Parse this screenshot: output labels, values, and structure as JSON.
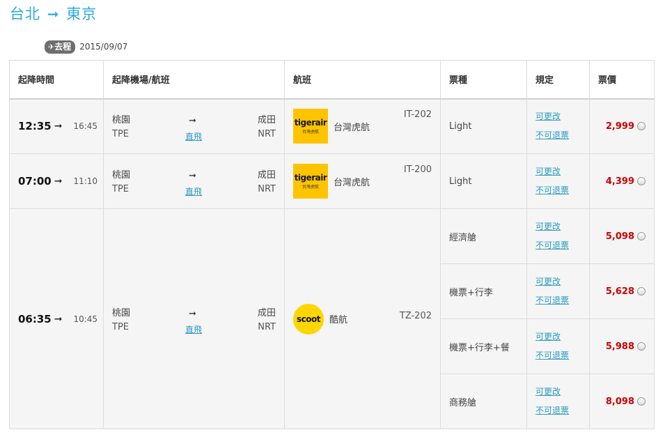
{
  "route": {
    "from": "台北",
    "arrow": "➞",
    "to": "東京"
  },
  "leg": {
    "badge_icon": "✈",
    "badge_label": "去程",
    "date": "2015/09/07"
  },
  "headers": {
    "time": "起降時間",
    "airport": "起降機場/航班",
    "flight": "航班",
    "fare": "票種",
    "rule": "規定",
    "price": "票價"
  },
  "flights": [
    {
      "dep": "12:35",
      "arr": "16:45",
      "from_name": "桃園",
      "from_code": "TPE",
      "to_name": "成田",
      "to_code": "NRT",
      "direct": "直飛",
      "carrier": "台灣虎航",
      "logo": "tigerair",
      "logo_sub": "台灣虎航",
      "flight_no": "IT-202",
      "fares": [
        {
          "type": "Light",
          "change": "可更改",
          "refund": "不可退票",
          "price": "2,999"
        }
      ]
    },
    {
      "dep": "07:00",
      "arr": "11:10",
      "from_name": "桃園",
      "from_code": "TPE",
      "to_name": "成田",
      "to_code": "NRT",
      "direct": "直飛",
      "carrier": "台灣虎航",
      "logo": "tigerair",
      "logo_sub": "台灣虎航",
      "flight_no": "IT-200",
      "fares": [
        {
          "type": "Light",
          "change": "可更改",
          "refund": "不可退票",
          "price": "4,399"
        }
      ]
    },
    {
      "dep": "06:35",
      "arr": "10:45",
      "from_name": "桃園",
      "from_code": "TPE",
      "to_name": "成田",
      "to_code": "NRT",
      "direct": "直飛",
      "carrier": "酷航",
      "logo": "scoot",
      "flight_no": "TZ-202",
      "fares": [
        {
          "type": "經濟艙",
          "change": "可更改",
          "refund": "不可退票",
          "price": "5,098"
        },
        {
          "type": "機票+行李",
          "change": "可更改",
          "refund": "不可退票",
          "price": "5,628"
        },
        {
          "type": "機票+行李+餐",
          "change": "可更改",
          "refund": "不可退票",
          "price": "5,988"
        },
        {
          "type": "商務艙",
          "change": "可更改",
          "refund": "不可退票",
          "price": "8,098"
        }
      ]
    }
  ],
  "colors": {
    "accent": "#29a9e0",
    "link": "#2a9bc4",
    "price": "#cc0000",
    "tiger_yellow": "#ffc400",
    "scoot_yellow": "#ffd600"
  }
}
